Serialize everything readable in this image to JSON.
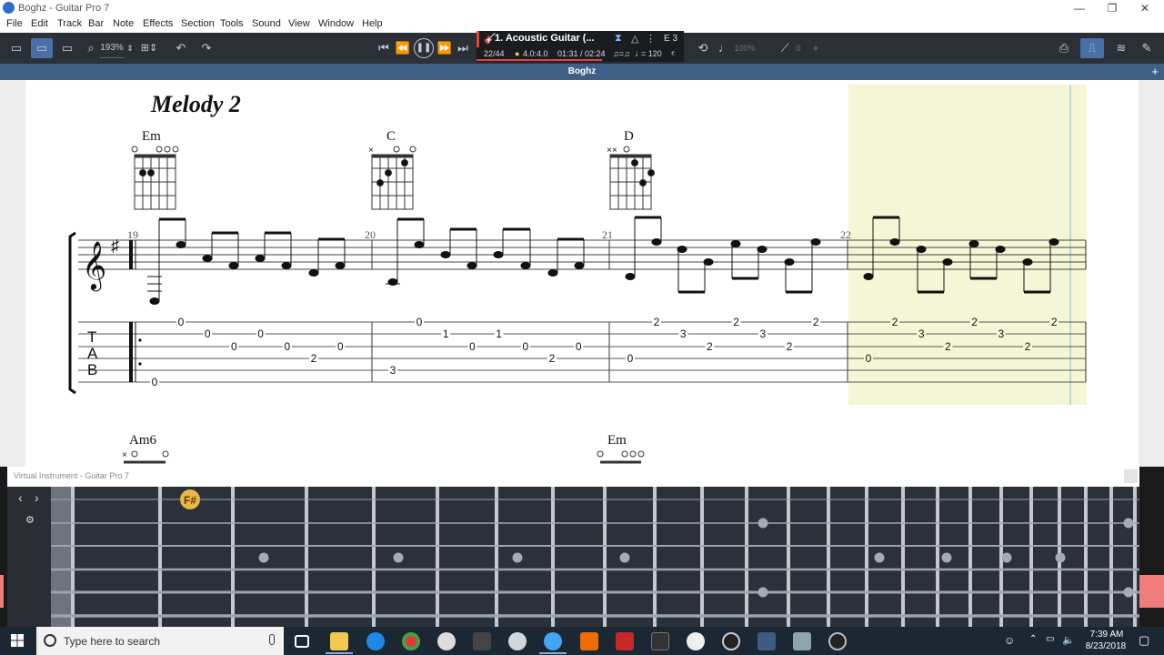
{
  "window": {
    "title": "Boghz - Guitar Pro 7",
    "controls": [
      "—",
      "❐",
      "✕"
    ]
  },
  "menu": [
    "File",
    "Edit",
    "Track",
    "Bar",
    "Note",
    "Effects",
    "Section",
    "Tools",
    "Sound",
    "View",
    "Window",
    "Help"
  ],
  "toolbar": {
    "zoom": "193%",
    "lcd": {
      "track_name": "1. Acoustic Guitar (...",
      "bar_position": "22/44",
      "beat": "4.0:4.0",
      "time": "01:31 / 02:24",
      "tempo": "= 120",
      "key": "E 3",
      "relative_speed": "100%",
      "capo": "0"
    }
  },
  "document_tab": "Boghz",
  "score": {
    "section_title": "Melody 2",
    "chords": [
      "Em",
      "C",
      "D"
    ],
    "chords_next_system": [
      "Am6",
      "Em"
    ],
    "bar_numbers": [
      "19",
      "20",
      "21",
      "22"
    ],
    "tab_clef": [
      "T",
      "A",
      "B"
    ],
    "tab_bars": [
      {
        "notes": [
          {
            "string": 1,
            "fret": "0"
          },
          {
            "string": 2,
            "fret": "0"
          },
          {
            "string": 3,
            "fret": "0"
          },
          {
            "string": 2,
            "fret": "0"
          },
          {
            "string": 3,
            "fret": "0"
          },
          {
            "string": 4,
            "fret": "2"
          },
          {
            "string": 3,
            "fret": "0"
          },
          {
            "string": 6,
            "fret": "0"
          }
        ]
      },
      {
        "notes": [
          {
            "string": 1,
            "fret": "0"
          },
          {
            "string": 2,
            "fret": "1"
          },
          {
            "string": 3,
            "fret": "0"
          },
          {
            "string": 2,
            "fret": "1"
          },
          {
            "string": 3,
            "fret": "0"
          },
          {
            "string": 4,
            "fret": "2"
          },
          {
            "string": 3,
            "fret": "0"
          },
          {
            "string": 5,
            "fret": "3"
          }
        ]
      },
      {
        "notes": [
          {
            "string": 1,
            "fret": "2"
          },
          {
            "string": 2,
            "fret": "3"
          },
          {
            "string": 3,
            "fret": "2"
          },
          {
            "string": 1,
            "fret": "2"
          },
          {
            "string": 2,
            "fret": "3"
          },
          {
            "string": 3,
            "fret": "2"
          },
          {
            "string": 1,
            "fret": "2"
          },
          {
            "string": 4,
            "fret": "0"
          }
        ]
      },
      {
        "notes": [
          {
            "string": 1,
            "fret": "2"
          },
          {
            "string": 2,
            "fret": "3"
          },
          {
            "string": 3,
            "fret": "2"
          },
          {
            "string": 1,
            "fret": "2"
          },
          {
            "string": 2,
            "fret": "3"
          },
          {
            "string": 3,
            "fret": "2"
          },
          {
            "string": 1,
            "fret": "2"
          },
          {
            "string": 4,
            "fret": "0"
          }
        ]
      }
    ]
  },
  "virtual_instrument": {
    "title": "Virtual Instrument - Guitar Pro 7",
    "active_note": "F#"
  },
  "taskbar": {
    "search_placeholder": "Type here to search",
    "time": "7:39 AM",
    "date": "8/23/2018"
  },
  "colors": {
    "accent": "#4a6fa8",
    "playback_highlight": "#f5f6d5",
    "active_note": "#e8b84a"
  }
}
